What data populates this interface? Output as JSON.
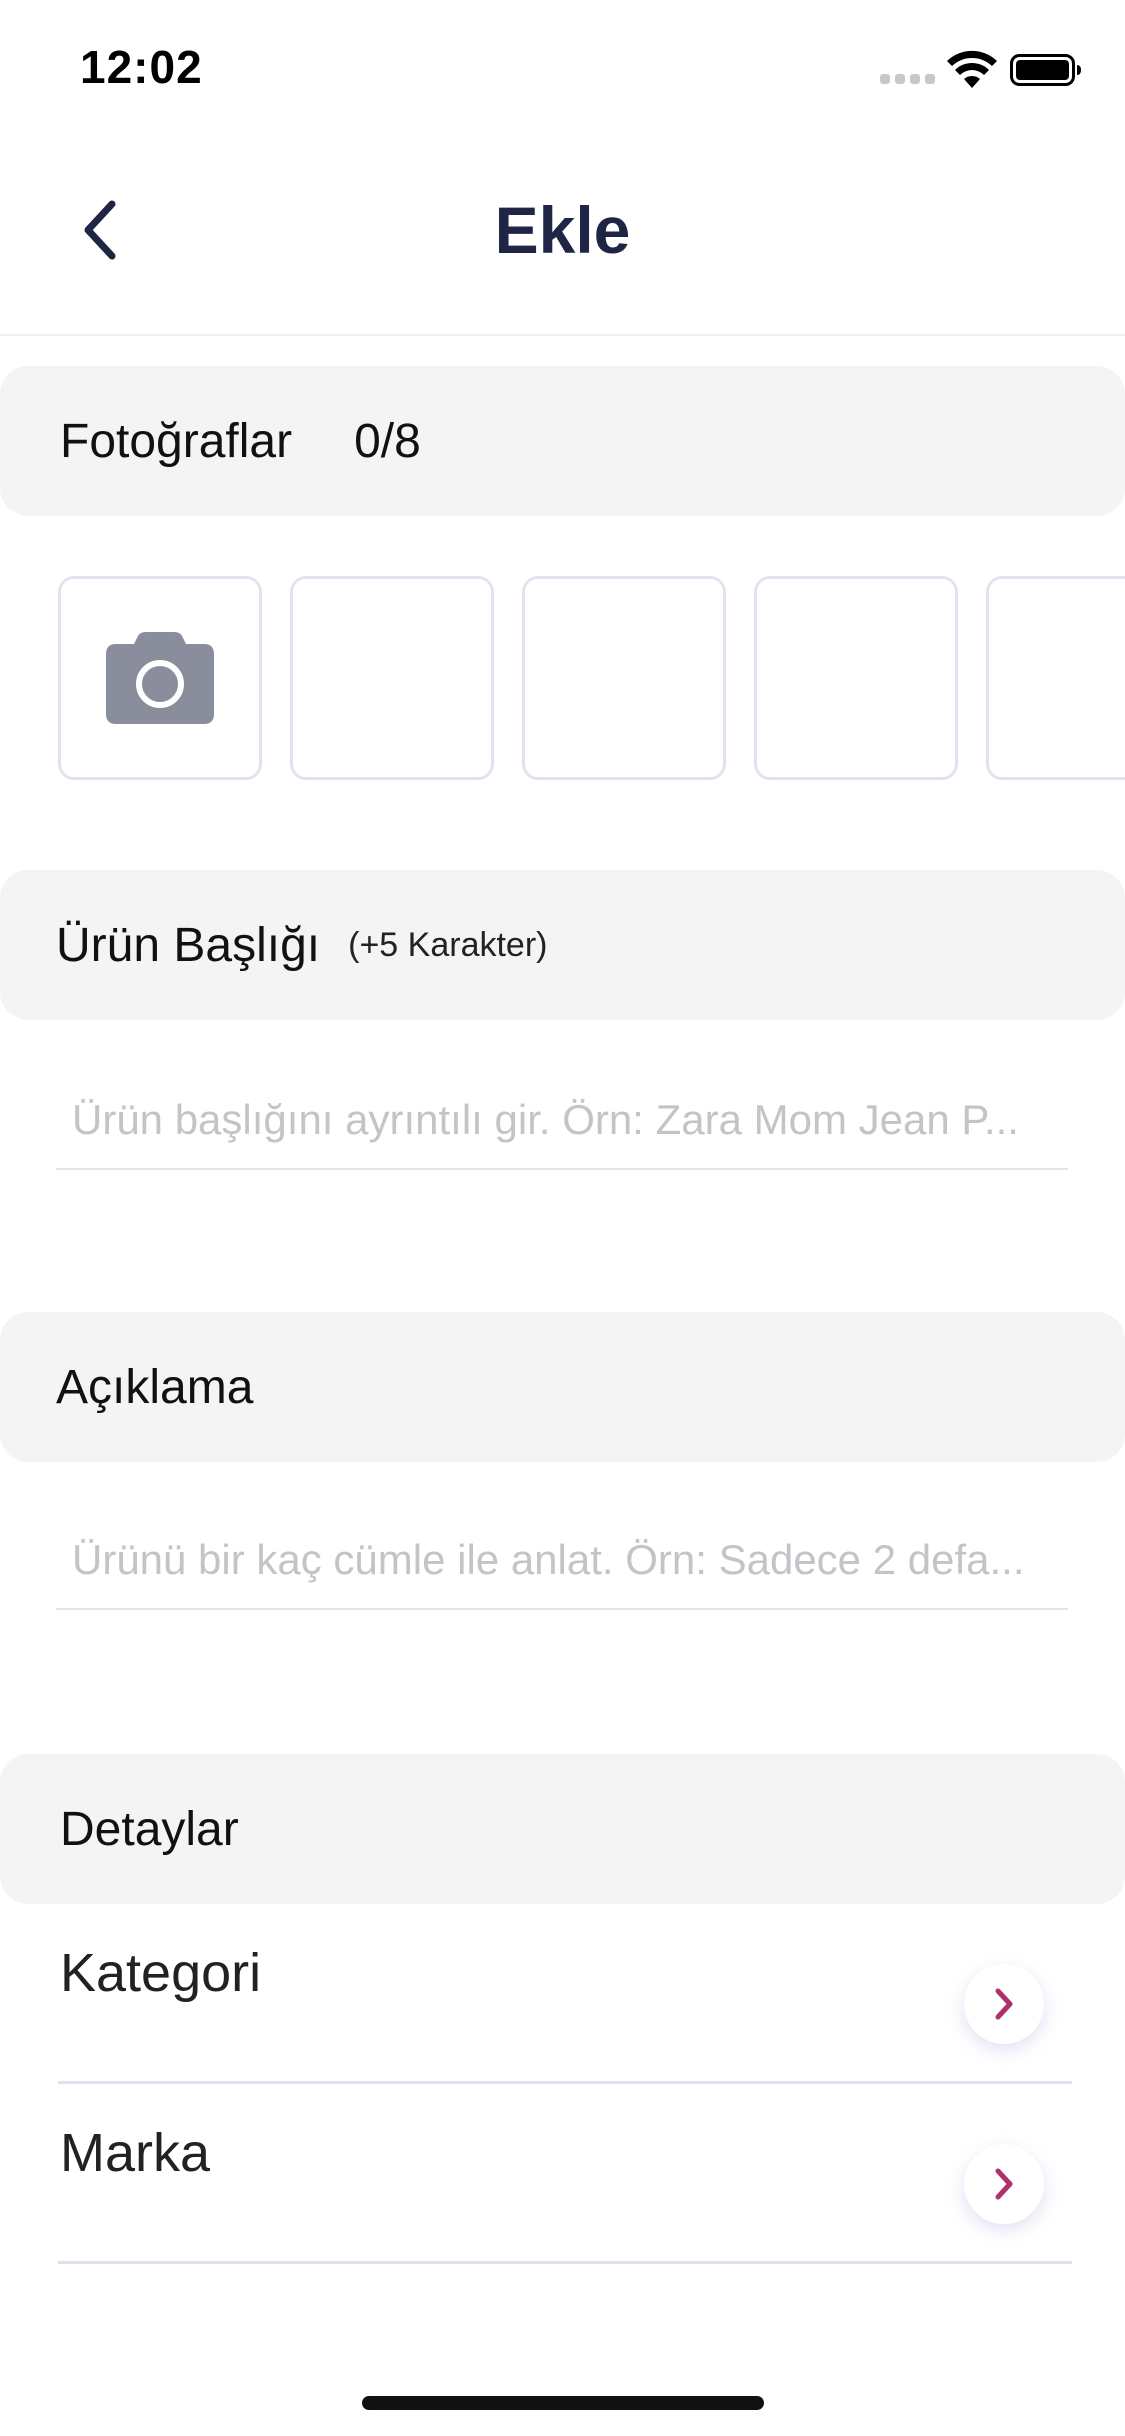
{
  "status_bar": {
    "time": "12:02"
  },
  "nav": {
    "title": "Ekle",
    "back_icon": "chevron-left-icon"
  },
  "photos": {
    "title": "Fotoğraflar",
    "count": "0/8",
    "camera_icon": "camera-icon",
    "slot_count": 8
  },
  "product_title": {
    "title": "Ürün Başlığı",
    "hint": "(+5 Karakter)",
    "placeholder": "Ürün başlığını ayrıntılı gir. Örn: Zara Mom Jean P...",
    "value": ""
  },
  "description": {
    "title": "Açıklama",
    "placeholder": "Ürünü bir kaç cümle ile anlat. Örn: Sadece 2 defa...",
    "value": ""
  },
  "details": {
    "title": "Detaylar",
    "items": [
      {
        "label": "Kategori"
      },
      {
        "label": "Marka"
      }
    ]
  },
  "colors": {
    "title_navy": "#1e2545",
    "section_bg": "#f4f4f5",
    "accent_chevron": "#b0306d",
    "divider": "#dde3ec",
    "camera_icon": "#8a8d9c"
  }
}
